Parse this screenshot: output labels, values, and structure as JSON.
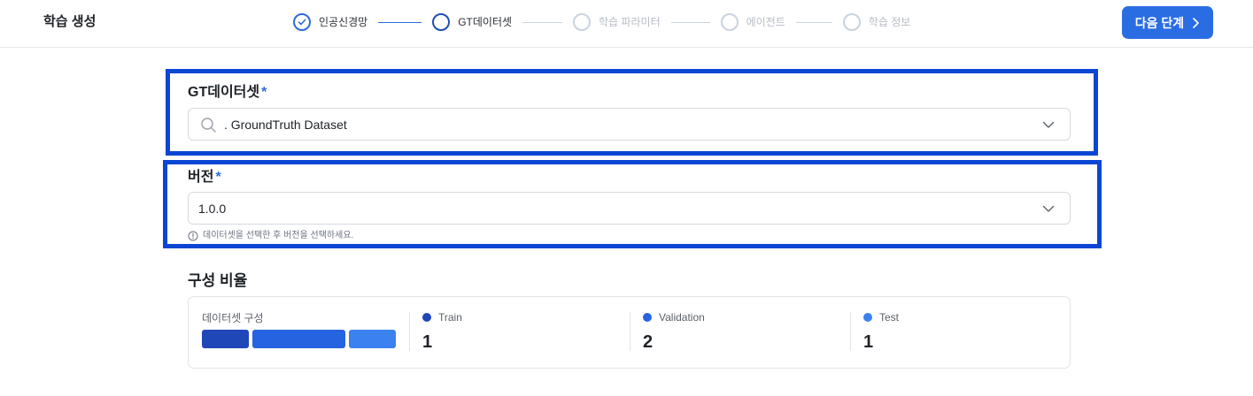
{
  "header": {
    "title": "학습 생성",
    "next_button": "다음 단계",
    "steps": [
      {
        "label": "인공신경망",
        "state": "done"
      },
      {
        "label": "GT데이터셋",
        "state": "current"
      },
      {
        "label": "학습 파라미터",
        "state": "pending"
      },
      {
        "label": "에이전트",
        "state": "pending"
      },
      {
        "label": "학습 정보",
        "state": "pending"
      }
    ]
  },
  "dataset": {
    "label": "GT데이터셋",
    "required_mark": "*",
    "value": ". GroundTruth Dataset"
  },
  "version": {
    "label": "버전",
    "required_mark": "*",
    "value": "1.0.0",
    "helper": "데이터셋을 선택한 후 버전을 선택하세요."
  },
  "ratio": {
    "title": "구성 비율",
    "composition_label": "데이터셋 구성",
    "splits": [
      {
        "name": "Train",
        "count": "1",
        "color": "#1f47b8"
      },
      {
        "name": "Validation",
        "count": "2",
        "color": "#2563e0"
      },
      {
        "name": "Test",
        "count": "1",
        "color": "#3b82f0"
      }
    ]
  },
  "colors": {
    "accent": "#2a6de3",
    "highlight": "#0a45d4"
  }
}
